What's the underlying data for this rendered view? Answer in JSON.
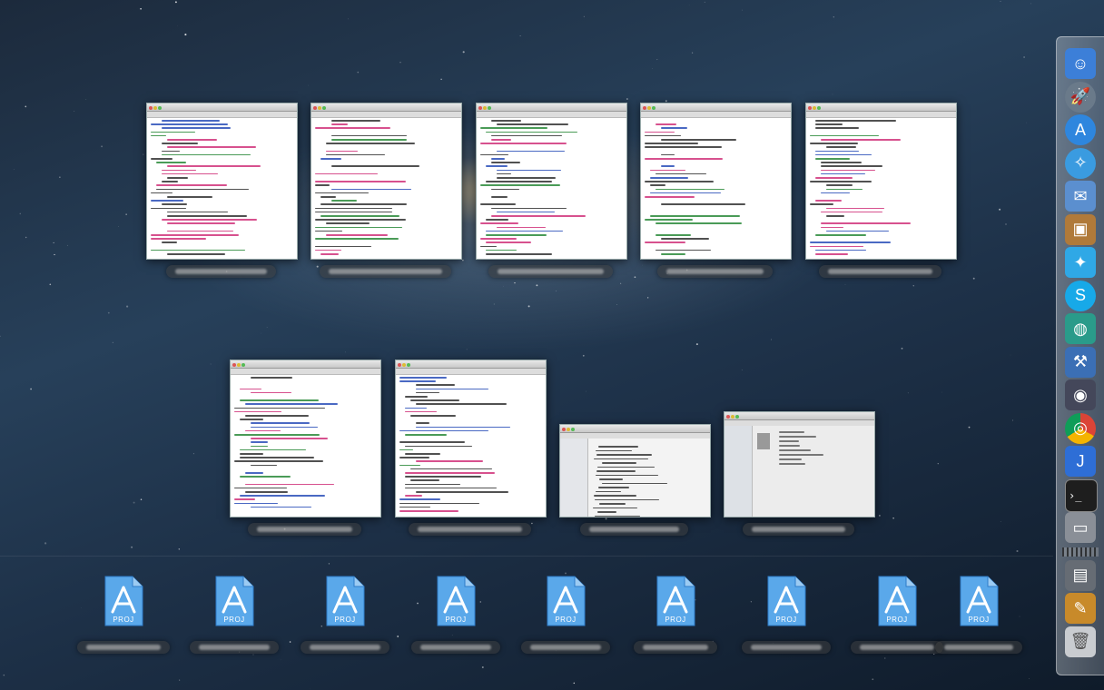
{
  "colors": {
    "doc_blue": "#5aa8ea",
    "doc_blue_dark": "#2e7bc8",
    "code_pink": "#d0327a",
    "code_green": "#2a8a3a",
    "code_blue": "#2a4fb8",
    "code_gray": "#333333"
  },
  "windows_row1": [
    {
      "name": "window-thumb-1",
      "tab": ""
    },
    {
      "name": "window-thumb-2",
      "tab": ""
    },
    {
      "name": "window-thumb-3",
      "tab": ""
    },
    {
      "name": "window-thumb-4",
      "tab": ""
    },
    {
      "name": "window-thumb-5",
      "tab": ""
    }
  ],
  "windows_row2": [
    {
      "name": "window-thumb-6"
    },
    {
      "name": "window-thumb-7"
    },
    {
      "name": "window-thumb-8"
    },
    {
      "name": "window-thumb-9"
    }
  ],
  "proj_icons": [
    {
      "badge": "PROJ"
    },
    {
      "badge": "PROJ"
    },
    {
      "badge": "PROJ"
    },
    {
      "badge": "PROJ"
    },
    {
      "badge": "PROJ"
    },
    {
      "badge": "PROJ"
    },
    {
      "badge": "PROJ"
    },
    {
      "badge": "PROJ"
    },
    {
      "badge": "PROJ"
    }
  ],
  "dock": [
    {
      "icon": "finder-icon",
      "color": "#3c7fd8"
    },
    {
      "icon": "launchpad-icon",
      "color": "#6a7a8a"
    },
    {
      "icon": "app-store-icon",
      "color": "#2e86de"
    },
    {
      "icon": "safari-icon",
      "color": "#3a9be0"
    },
    {
      "icon": "mail-icon",
      "color": "#5b8fcf"
    },
    {
      "icon": "preview-icon",
      "color": "#b07a3a"
    },
    {
      "icon": "twitter-icon",
      "color": "#2fa8e6"
    },
    {
      "icon": "skype-icon",
      "color": "#17a9e8"
    },
    {
      "icon": "wireshark-icon",
      "color": "#2a9b8a"
    },
    {
      "icon": "xcode-icon",
      "color": "#3b6fb5"
    },
    {
      "icon": "alfred-icon",
      "color": "#44475a"
    },
    {
      "icon": "chrome-icon",
      "color": "#e4a82a"
    },
    {
      "icon": "intellij-icon",
      "color": "#2e6ed6"
    },
    {
      "icon": "terminal-icon",
      "color": "#1e1e1e"
    },
    {
      "icon": "window-icon",
      "color": "#8a8f97"
    },
    {
      "icon": "downloads-stack-icon",
      "color": "#666c74"
    },
    {
      "icon": "applications-stack-icon",
      "color": "#c88a2a"
    },
    {
      "icon": "trash-icon",
      "color": "#c9ccd0"
    }
  ]
}
